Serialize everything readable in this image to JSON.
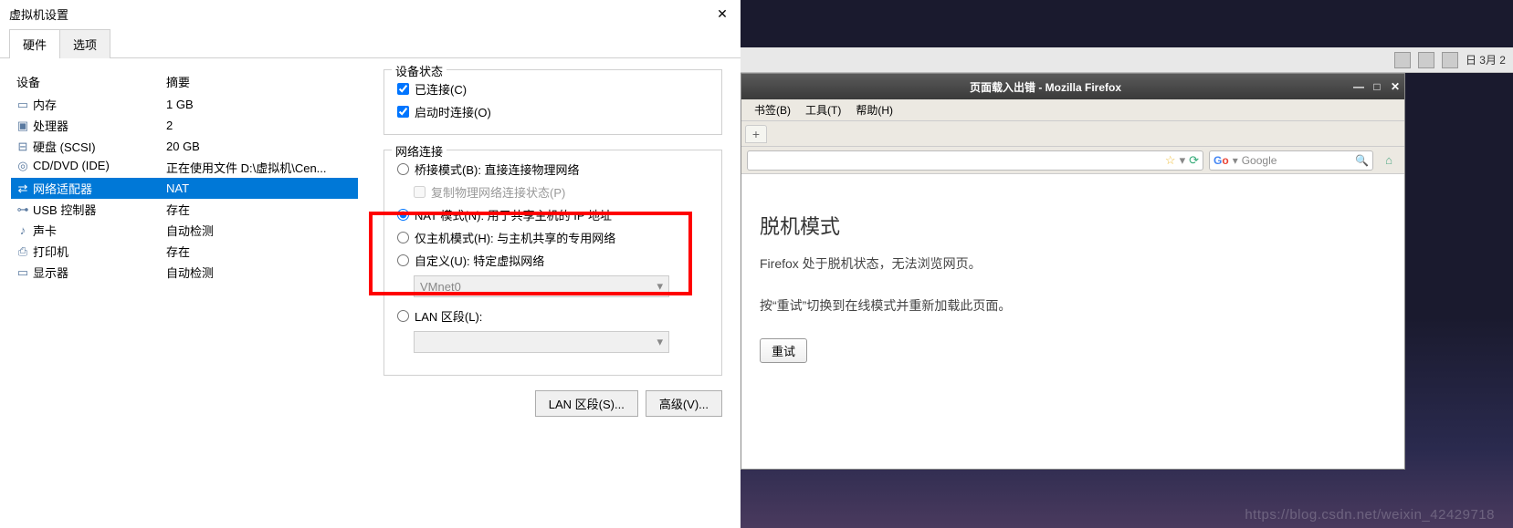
{
  "vm": {
    "title": "虚拟机设置",
    "close": "✕",
    "tabs": {
      "hardware": "硬件",
      "options": "选项"
    },
    "columns": {
      "device": "设备",
      "summary": "摘要"
    },
    "rows": [
      {
        "icon": "memory-icon",
        "device": "内存",
        "summary": "1 GB"
      },
      {
        "icon": "cpu-icon",
        "device": "处理器",
        "summary": "2"
      },
      {
        "icon": "disk-icon",
        "device": "硬盘 (SCSI)",
        "summary": "20 GB"
      },
      {
        "icon": "cd-icon",
        "device": "CD/DVD (IDE)",
        "summary": "正在使用文件 D:\\虚拟机\\Cen..."
      },
      {
        "icon": "net-icon",
        "device": "网络适配器",
        "summary": "NAT"
      },
      {
        "icon": "usb-icon",
        "device": "USB 控制器",
        "summary": "存在"
      },
      {
        "icon": "sound-icon",
        "device": "声卡",
        "summary": "自动检测"
      },
      {
        "icon": "printer-icon",
        "device": "打印机",
        "summary": "存在"
      },
      {
        "icon": "display-icon",
        "device": "显示器",
        "summary": "自动检测"
      }
    ],
    "status": {
      "title": "设备状态",
      "connected": "已连接(C)",
      "connect_on": "启动时连接(O)"
    },
    "net": {
      "title": "网络连接",
      "bridged": "桥接模式(B): 直接连接物理网络",
      "replicate": "复制物理网络连接状态(P)",
      "nat": "NAT 模式(N): 用于共享主机的 IP 地址",
      "hostonly": "仅主机模式(H): 与主机共享的专用网络",
      "custom": "自定义(U): 特定虚拟网络",
      "vmnet": "VMnet0",
      "lanseg": "LAN 区段(L):"
    },
    "buttons": {
      "lan": "LAN 区段(S)...",
      "adv": "高级(V)..."
    }
  },
  "linux": {
    "time": "日 3月 2",
    "ff": {
      "title": "页面载入出错 - Mozilla Firefox",
      "menu": {
        "bookmarks": "书签(B)",
        "tools": "工具(T)",
        "help": "帮助(H)"
      },
      "search_placeholder": "Google",
      "heading": "脱机模式",
      "p1": "Firefox 处于脱机状态，无法浏览网页。",
      "p2": "按“重试”切换到在线模式并重新加载此页面。",
      "retry": "重试"
    }
  },
  "watermark": "https://blog.csdn.net/weixin_42429718"
}
